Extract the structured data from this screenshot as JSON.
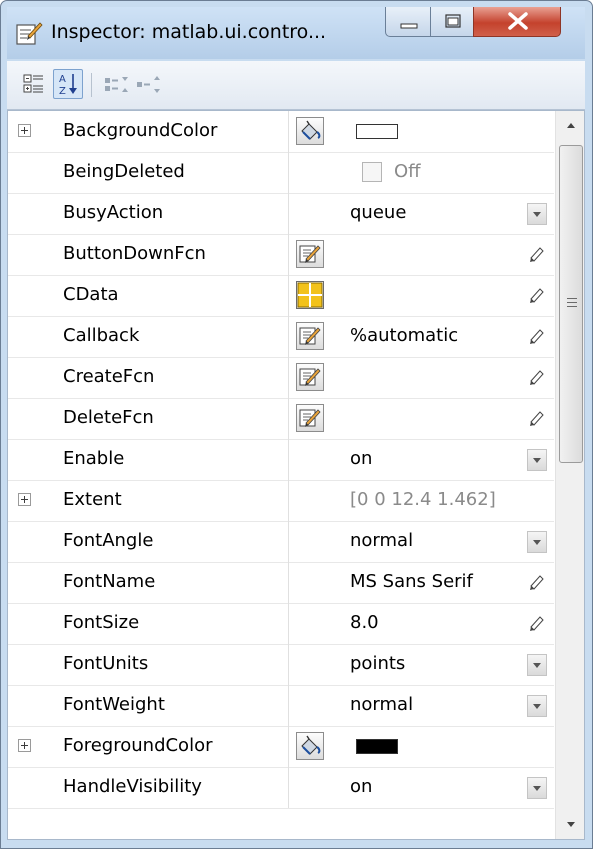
{
  "window": {
    "title": "Inspector:  matlab.ui.contro..."
  },
  "toolbar": {
    "buttons": [
      {
        "icon": "categorize-icon",
        "selected": false
      },
      {
        "icon": "sort-alphabetical-icon",
        "selected": true
      },
      {
        "icon": "expand-all-icon",
        "selected": false
      },
      {
        "icon": "collapse-all-icon",
        "selected": false
      }
    ]
  },
  "properties": [
    {
      "name": "BackgroundColor",
      "expandable": true,
      "editor": "color-picker",
      "value": "",
      "value_kind": "swatch",
      "swatch": "#ffffff",
      "control": "none"
    },
    {
      "name": "BeingDeleted",
      "expandable": false,
      "editor": "",
      "value": "Off",
      "value_kind": "checkbox",
      "control": "none"
    },
    {
      "name": "BusyAction",
      "expandable": false,
      "editor": "",
      "value": "queue",
      "value_kind": "text",
      "control": "dropdown"
    },
    {
      "name": "ButtonDownFcn",
      "expandable": false,
      "editor": "callback-editor",
      "value": "",
      "value_kind": "text",
      "control": "pencil"
    },
    {
      "name": "CData",
      "expandable": false,
      "editor": "array-editor",
      "value": "",
      "value_kind": "text",
      "control": "pencil"
    },
    {
      "name": "Callback",
      "expandable": false,
      "editor": "callback-editor",
      "value": "%automatic",
      "value_kind": "text",
      "control": "pencil"
    },
    {
      "name": "CreateFcn",
      "expandable": false,
      "editor": "callback-editor",
      "value": "",
      "value_kind": "text",
      "control": "pencil"
    },
    {
      "name": "DeleteFcn",
      "expandable": false,
      "editor": "callback-editor",
      "value": "",
      "value_kind": "text",
      "control": "pencil"
    },
    {
      "name": "Enable",
      "expandable": false,
      "editor": "",
      "value": "on",
      "value_kind": "text",
      "control": "dropdown"
    },
    {
      "name": "Extent",
      "expandable": true,
      "editor": "",
      "value": "[0 0 12.4 1.462]",
      "value_kind": "dim",
      "control": "none"
    },
    {
      "name": "FontAngle",
      "expandable": false,
      "editor": "",
      "value": "normal",
      "value_kind": "text",
      "control": "dropdown"
    },
    {
      "name": "FontName",
      "expandable": false,
      "editor": "",
      "value": "MS Sans Serif",
      "value_kind": "text",
      "control": "pencil"
    },
    {
      "name": "FontSize",
      "expandable": false,
      "editor": "",
      "value": "8.0",
      "value_kind": "text",
      "control": "pencil"
    },
    {
      "name": "FontUnits",
      "expandable": false,
      "editor": "",
      "value": "points",
      "value_kind": "text",
      "control": "dropdown"
    },
    {
      "name": "FontWeight",
      "expandable": false,
      "editor": "",
      "value": "normal",
      "value_kind": "text",
      "control": "dropdown"
    },
    {
      "name": "ForegroundColor",
      "expandable": true,
      "editor": "color-picker",
      "value": "",
      "value_kind": "swatch",
      "swatch": "#000000",
      "control": "none"
    },
    {
      "name": "HandleVisibility",
      "expandable": false,
      "editor": "",
      "value": "on",
      "value_kind": "text",
      "control": "dropdown"
    }
  ],
  "colors": {
    "titlebar": "#c8dcf0",
    "close_button": "#c4422d",
    "row_divider": "#e8e8e8"
  }
}
